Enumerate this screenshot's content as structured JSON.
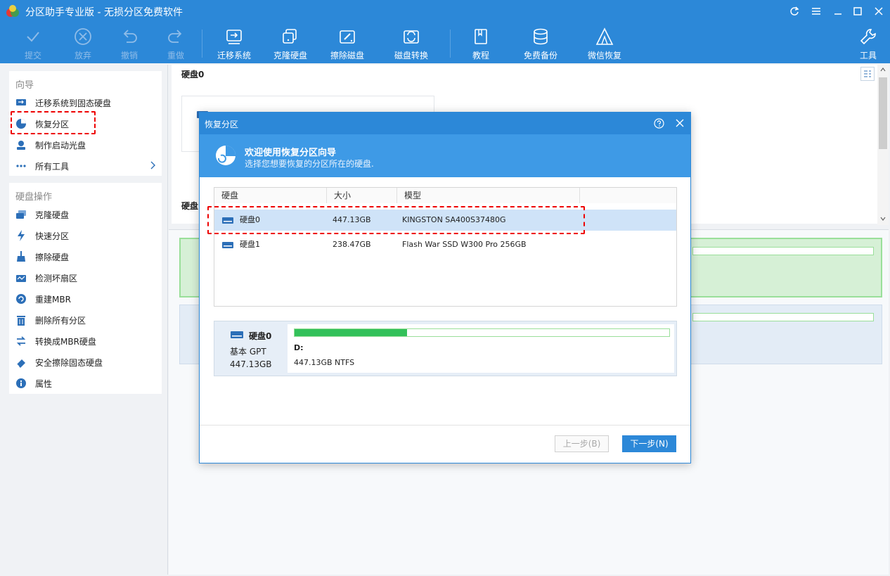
{
  "window": {
    "title": "分区助手专业版 - 无损分区免费软件"
  },
  "toolbar": {
    "commit": "提交",
    "discard": "放弃",
    "undo": "撤销",
    "redo": "重做",
    "migrate": "迁移系统",
    "clone": "克隆硬盘",
    "wipe": "擦除磁盘",
    "convert": "磁盘转换",
    "tutorial": "教程",
    "backup": "免费备份",
    "wechat": "微信恢复",
    "tools": "工具"
  },
  "sidebar": {
    "wizard_title": "向导",
    "wizard_items": [
      "迁移系统到固态硬盘",
      "恢复分区",
      "制作启动光盘",
      "所有工具"
    ],
    "disk_ops_title": "硬盘操作",
    "disk_ops_items": [
      "克隆硬盘",
      "快速分区",
      "擦除硬盘",
      "检测坏扇区",
      "重建MBR",
      "删除所有分区",
      "转换成MBR硬盘",
      "安全擦除固态硬盘",
      "属性"
    ]
  },
  "main": {
    "disk0_label": "硬盘0",
    "disk_label_partial": "硬盘"
  },
  "dialog": {
    "title": "恢复分区",
    "header_title": "欢迎使用恢复分区向导",
    "header_subtitle": "选择您想要恢复的分区所在的硬盘.",
    "columns": [
      "硬盘",
      "大小",
      "模型"
    ],
    "rows": [
      {
        "disk": "硬盘0",
        "size": "447.13GB",
        "model": "KINGSTON SA400S37480G"
      },
      {
        "disk": "硬盘1",
        "size": "238.47GB",
        "model": "Flash War SSD W300 Pro 256GB"
      }
    ],
    "card": {
      "disk": "硬盘0",
      "type": "基本 GPT",
      "size": "447.13GB",
      "partition_letter": "D:",
      "partition_info": "447.13GB NTFS",
      "used_fraction": 0.3
    },
    "prev": "上一步(B)",
    "next": "下一步(N)"
  },
  "colors": {
    "accent": "#2c88d8",
    "highlight": "#e00000",
    "usage_bar": "#33c15a"
  }
}
